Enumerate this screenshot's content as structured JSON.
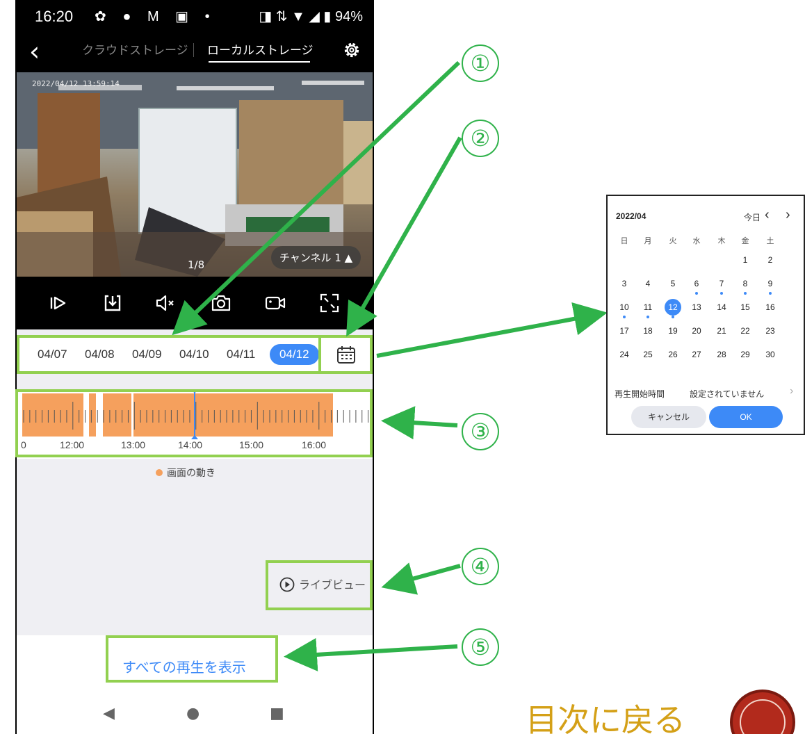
{
  "status_bar": {
    "time": "16:20",
    "icons": "✿ ● M ▣ •",
    "right": "◨ ⇅ ▼ ◢ ▮ 94%"
  },
  "app_bar": {
    "back_icon": "chevron-left-icon",
    "back_glyph": "‹",
    "tab_cloud": "クラウドストレージ",
    "tab_local": "ローカルストレージ",
    "settings_icon": "gear-icon"
  },
  "video": {
    "timestamp": "2022/04/12 13:59:14",
    "counter": "1/8",
    "channel": "チャンネル 1 ▲"
  },
  "controls": [
    "play-step-icon",
    "download-icon",
    "mute-icon",
    "snapshot-icon",
    "record-icon",
    "fullscreen-icon"
  ],
  "dates": [
    "04/07",
    "04/08",
    "04/09",
    "04/10",
    "04/11",
    "04/12"
  ],
  "selected_date": "04/12",
  "timeline": {
    "labels": [
      "0",
      "12:00",
      "13:00",
      "14:00",
      "15:00",
      "16:00"
    ],
    "marker_time": "14:00",
    "motion_color": "#f5a05d"
  },
  "legend": {
    "label": "画面の動き"
  },
  "liveview": {
    "label": "ライブビュー"
  },
  "show_all": "すべての再生を表示",
  "nav": {
    "back": "◀",
    "home": "●",
    "recents": "■"
  },
  "callouts": [
    "①",
    "②",
    "③",
    "④",
    "⑤"
  ],
  "calendar": {
    "month": "2022/04",
    "today": "今日",
    "prev": "‹",
    "next": "›",
    "weekdays": [
      "日",
      "月",
      "火",
      "水",
      "木",
      "金",
      "土"
    ],
    "weeks": [
      [
        "",
        "",
        "",
        "",
        "",
        "1",
        "2"
      ],
      [
        "3",
        "4",
        "5",
        "6",
        "7",
        "8",
        "9"
      ],
      [
        "10",
        "11",
        "12",
        "13",
        "14",
        "15",
        "16"
      ],
      [
        "17",
        "18",
        "19",
        "20",
        "21",
        "22",
        "23"
      ],
      [
        "24",
        "25",
        "26",
        "27",
        "28",
        "29",
        "30"
      ]
    ],
    "selected_day": "12",
    "marked_days": [
      "6",
      "7",
      "8",
      "9",
      "10",
      "11",
      "12"
    ],
    "start_time_label": "再生開始時間",
    "start_time_value": "設定されていません",
    "cancel": "キャンセル",
    "ok": "OK"
  },
  "back_to_toc": "目次に戻る",
  "accent": "#3d8af7",
  "highlight_color": "#92d050",
  "arrow_color": "#2fb24a"
}
